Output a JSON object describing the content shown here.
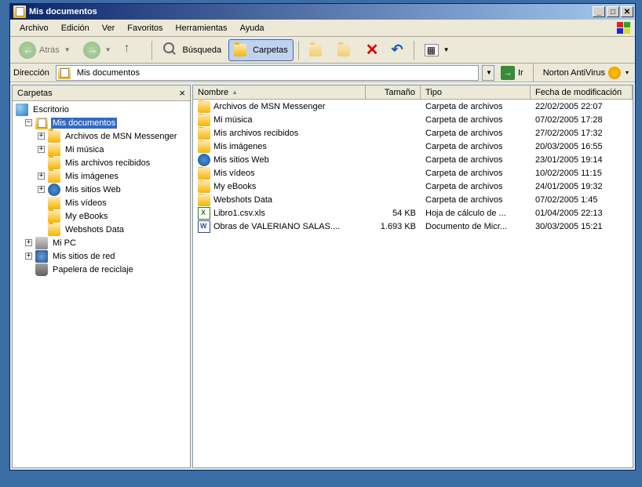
{
  "window": {
    "title": "Mis documentos"
  },
  "menu": {
    "archivo": "Archivo",
    "edicion": "Edición",
    "ver": "Ver",
    "favoritos": "Favoritos",
    "herramientas": "Herramientas",
    "ayuda": "Ayuda"
  },
  "toolbar": {
    "atras": "Atrás",
    "busqueda": "Búsqueda",
    "carpetas": "Carpetas"
  },
  "addr": {
    "label": "Dirección",
    "value": "Mis documentos",
    "ir": "Ir",
    "norton": "Norton AntiVirus"
  },
  "treehdr": {
    "title": "Carpetas"
  },
  "tree": {
    "escritorio": "Escritorio",
    "misdocs": "Mis documentos",
    "msn": "Archivos de MSN Messenger",
    "musica": "Mi música",
    "recibidos": "Mis archivos recibidos",
    "imagenes": "Mis imágenes",
    "sitiosweb": "Mis sitios Web",
    "videos": "Mis vídeos",
    "ebooks": "My eBooks",
    "webshots": "Webshots Data",
    "mipc": "Mi PC",
    "red": "Mis sitios de red",
    "papelera": "Papelera de reciclaje"
  },
  "cols": {
    "nombre": "Nombre",
    "tamano": "Tamaño",
    "tipo": "Tipo",
    "fecha": "Fecha de modificación"
  },
  "rows": [
    {
      "icon": "folder",
      "name": "Archivos de MSN Messenger",
      "size": "",
      "type": "Carpeta de archivos",
      "date": "22/02/2005 22:07"
    },
    {
      "icon": "folder",
      "name": "Mi música",
      "size": "",
      "type": "Carpeta de archivos",
      "date": "07/02/2005 17:28"
    },
    {
      "icon": "folder",
      "name": "Mis archivos recibidos",
      "size": "",
      "type": "Carpeta de archivos",
      "date": "27/02/2005 17:32"
    },
    {
      "icon": "folder",
      "name": "Mis imágenes",
      "size": "",
      "type": "Carpeta de archivos",
      "date": "20/03/2005 16:55"
    },
    {
      "icon": "web",
      "name": "Mis sitios Web",
      "size": "",
      "type": "Carpeta de archivos",
      "date": "23/01/2005 19:14"
    },
    {
      "icon": "folder",
      "name": "Mis vídeos",
      "size": "",
      "type": "Carpeta de archivos",
      "date": "10/02/2005 11:15"
    },
    {
      "icon": "folder",
      "name": "My eBooks",
      "size": "",
      "type": "Carpeta de archivos",
      "date": "24/01/2005 19:32"
    },
    {
      "icon": "folder",
      "name": "Webshots Data",
      "size": "",
      "type": "Carpeta de archivos",
      "date": "07/02/2005 1:45"
    },
    {
      "icon": "excel",
      "name": "Libro1.csv.xls",
      "size": "54 KB",
      "type": "Hoja de cálculo de ...",
      "date": "01/04/2005 22:13"
    },
    {
      "icon": "word",
      "name": "Obras de VALERIANO SALAS....",
      "size": "1.693 KB",
      "type": "Documento de Micr...",
      "date": "30/03/2005 15:21"
    }
  ]
}
